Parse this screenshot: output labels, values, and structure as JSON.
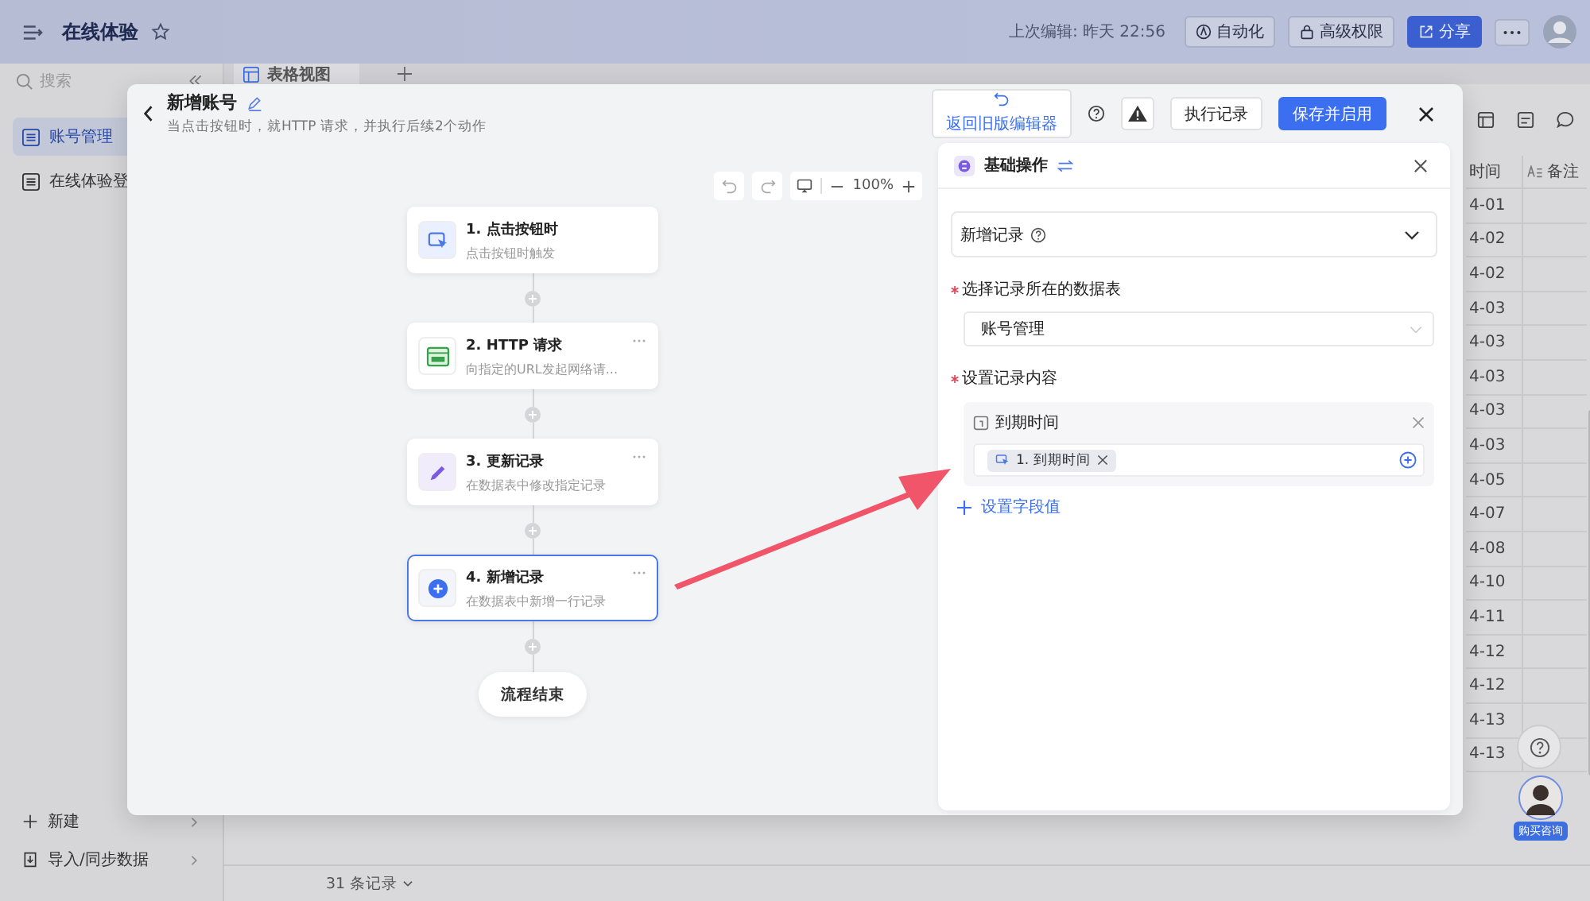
{
  "app": {
    "title": "在线体验",
    "last_edited": "上次编辑: 昨天 22:56",
    "actions": [
      {
        "label": "自动化",
        "kind": "automation"
      },
      {
        "label": "高级权限",
        "kind": "lock"
      },
      {
        "label": "分享",
        "kind": "share"
      }
    ]
  },
  "sidebar": {
    "search_placeholder": "搜索",
    "items": [
      {
        "label": "账号管理",
        "selected": true
      },
      {
        "label": "在线体验登",
        "selected": false
      }
    ],
    "footer": [
      {
        "label": "新建",
        "kind": "new"
      },
      {
        "label": "导入/同步数据",
        "kind": "import"
      }
    ]
  },
  "view_tabs": [
    {
      "label": "表格视图",
      "selected": true
    }
  ],
  "table": {
    "columns": [
      {
        "label": "时间",
        "kind": "plain"
      },
      {
        "label": "备注",
        "kind": "text"
      }
    ],
    "rows": [
      "4-01",
      "4-02",
      "4-02",
      "4-03",
      "4-03",
      "4-03",
      "4-03",
      "4-03",
      "4-05",
      "4-07",
      "4-08",
      "4-10",
      "4-11",
      "4-12",
      "4-12",
      "4-13",
      "4-13"
    ],
    "record_count": "31 条记录"
  },
  "support_badge": "购买咨询",
  "modal": {
    "title": "新增账号",
    "subtitle": "当点击按钮时，就HTTP 请求，并执行后续2个动作",
    "buttons": [
      {
        "label": "返回旧版编辑器",
        "kind": "link"
      },
      {
        "label": "执行记录",
        "kind": "default"
      },
      {
        "label": "保存并启用",
        "kind": "primary"
      }
    ],
    "zoom": "100%",
    "nodes": [
      {
        "title": "1. 点击按钮时",
        "description": "点击按钮时触发",
        "kind": "trigger",
        "selected": false,
        "has_menu": false
      },
      {
        "title": "2. HTTP 请求",
        "description": "向指定的URL发起网络请...",
        "kind": "http",
        "selected": false,
        "has_menu": true
      },
      {
        "title": "3. 更新记录",
        "description": "在数据表中修改指定记录",
        "kind": "update",
        "selected": false,
        "has_menu": true
      },
      {
        "title": "4. 新增记录",
        "description": "在数据表中新增一行记录",
        "kind": "create",
        "selected": true,
        "has_menu": true
      }
    ],
    "end_label": "流程结束",
    "panel": {
      "title": "基础操作",
      "action": "新增记录",
      "table_label": "选择记录所在的数据表",
      "table_required": true,
      "table_value": "账号管理",
      "content_label": "设置记录内容",
      "content_required": true,
      "fields": [
        {
          "name": "到期时间",
          "values": [
            "1. 到期时间"
          ]
        }
      ],
      "add_field": "设置字段值"
    }
  }
}
